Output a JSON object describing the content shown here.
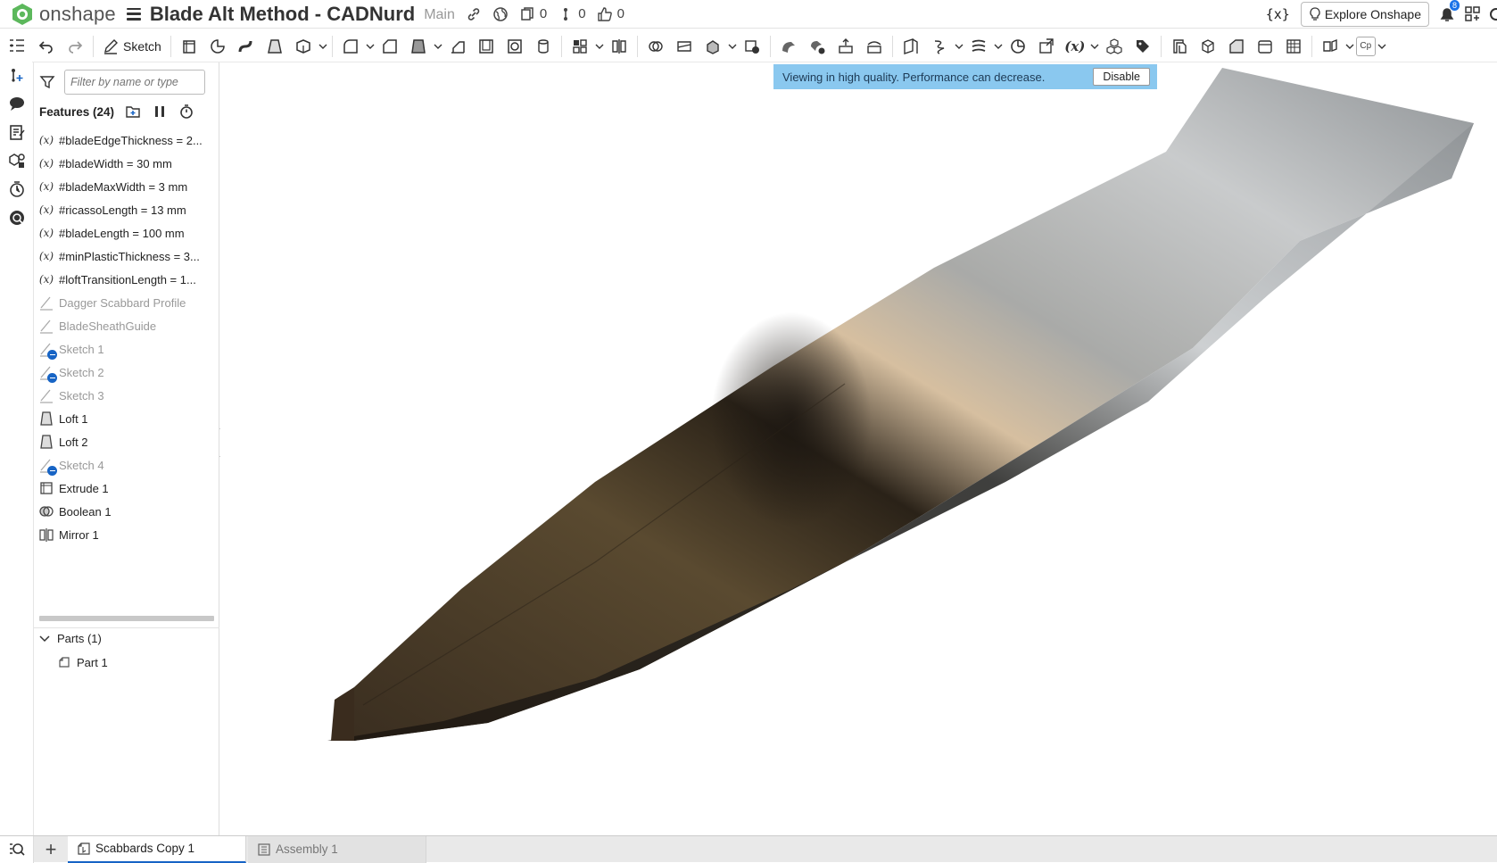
{
  "app": {
    "brand": "onshape",
    "document_title": "Blade Alt Method - CADNurd",
    "workspace": "Main",
    "counts": {
      "versions": "0",
      "branches": "0",
      "likes": "0"
    },
    "notifications_badge": "8",
    "explore_label": "Explore Onshape",
    "fx_label": "{x}"
  },
  "toolbar": {
    "sketch_label": "Sketch",
    "tools": [
      "undo-icon",
      "redo-icon",
      "extrude-icon",
      "revolve-icon",
      "sweep-icon",
      "loft-icon",
      "thicken-icon",
      "fillet-icon",
      "chamfer-icon",
      "draft-icon",
      "rib-icon",
      "shell-icon",
      "hole-icon",
      "cylinder-icon",
      "pattern-icon",
      "mirror-icon",
      "boolean-icon",
      "split-icon",
      "transform-icon",
      "delete-part-icon",
      "modify-fillet-icon",
      "replace-face-icon",
      "move-face-icon",
      "offset-surface-icon",
      "plane-icon",
      "helix-icon",
      "mate-connector-icon",
      "measure-icon",
      "import-icon",
      "variable-icon",
      "composite-part-icon",
      "tag-icon",
      "sheet-metal-icon",
      "frame-icon",
      "wrap-icon",
      "enclose-icon",
      "surface-icon",
      "section-icon",
      "cp-icon"
    ],
    "cp_label": "Cp"
  },
  "feature_panel": {
    "filter_placeholder": "Filter by name or type",
    "title": "Features (24)",
    "items": [
      {
        "label": "#bladeEdgeThickness = 2...",
        "type": "variable",
        "dim": false
      },
      {
        "label": "#bladeWidth = 30 mm",
        "type": "variable",
        "dim": false
      },
      {
        "label": "#bladeMaxWidth = 3 mm",
        "type": "variable",
        "dim": false
      },
      {
        "label": "#ricassoLength = 13 mm",
        "type": "variable",
        "dim": false
      },
      {
        "label": "#bladeLength = 100 mm",
        "type": "variable",
        "dim": false
      },
      {
        "label": "#minPlasticThickness = 3...",
        "type": "variable",
        "dim": false
      },
      {
        "label": "#loftTransitionLength = 1...",
        "type": "variable",
        "dim": false
      },
      {
        "label": "Dagger Scabbard Profile",
        "type": "sketch",
        "dim": true
      },
      {
        "label": "BladeSheathGuide",
        "type": "sketch",
        "dim": true
      },
      {
        "label": "Sketch 1",
        "type": "sketch-suppressed",
        "dim": true
      },
      {
        "label": "Sketch 2",
        "type": "sketch-suppressed",
        "dim": true
      },
      {
        "label": "Sketch 3",
        "type": "sketch",
        "dim": true
      },
      {
        "label": "Loft 1",
        "type": "loft",
        "dim": false
      },
      {
        "label": "Loft 2",
        "type": "loft",
        "dim": false
      },
      {
        "label": "Sketch 4",
        "type": "sketch-suppressed",
        "dim": true
      },
      {
        "label": "Extrude 1",
        "type": "extrude",
        "dim": false
      },
      {
        "label": "Boolean 1",
        "type": "boolean",
        "dim": false
      },
      {
        "label": "Mirror 1",
        "type": "mirror",
        "dim": false
      }
    ],
    "parts_label": "Parts (1)",
    "parts": [
      "Part 1"
    ]
  },
  "viewport": {
    "banner_text": "Viewing in high quality. Performance can decrease.",
    "disable_label": "Disable"
  },
  "tabs": [
    {
      "label": "Scabbards Copy 1",
      "active": true
    },
    {
      "label": "Assembly 1",
      "active": false
    }
  ],
  "colors": {
    "accent": "#1764c5",
    "banner": "#8ac8ef",
    "logo_green": "#4caf50"
  }
}
